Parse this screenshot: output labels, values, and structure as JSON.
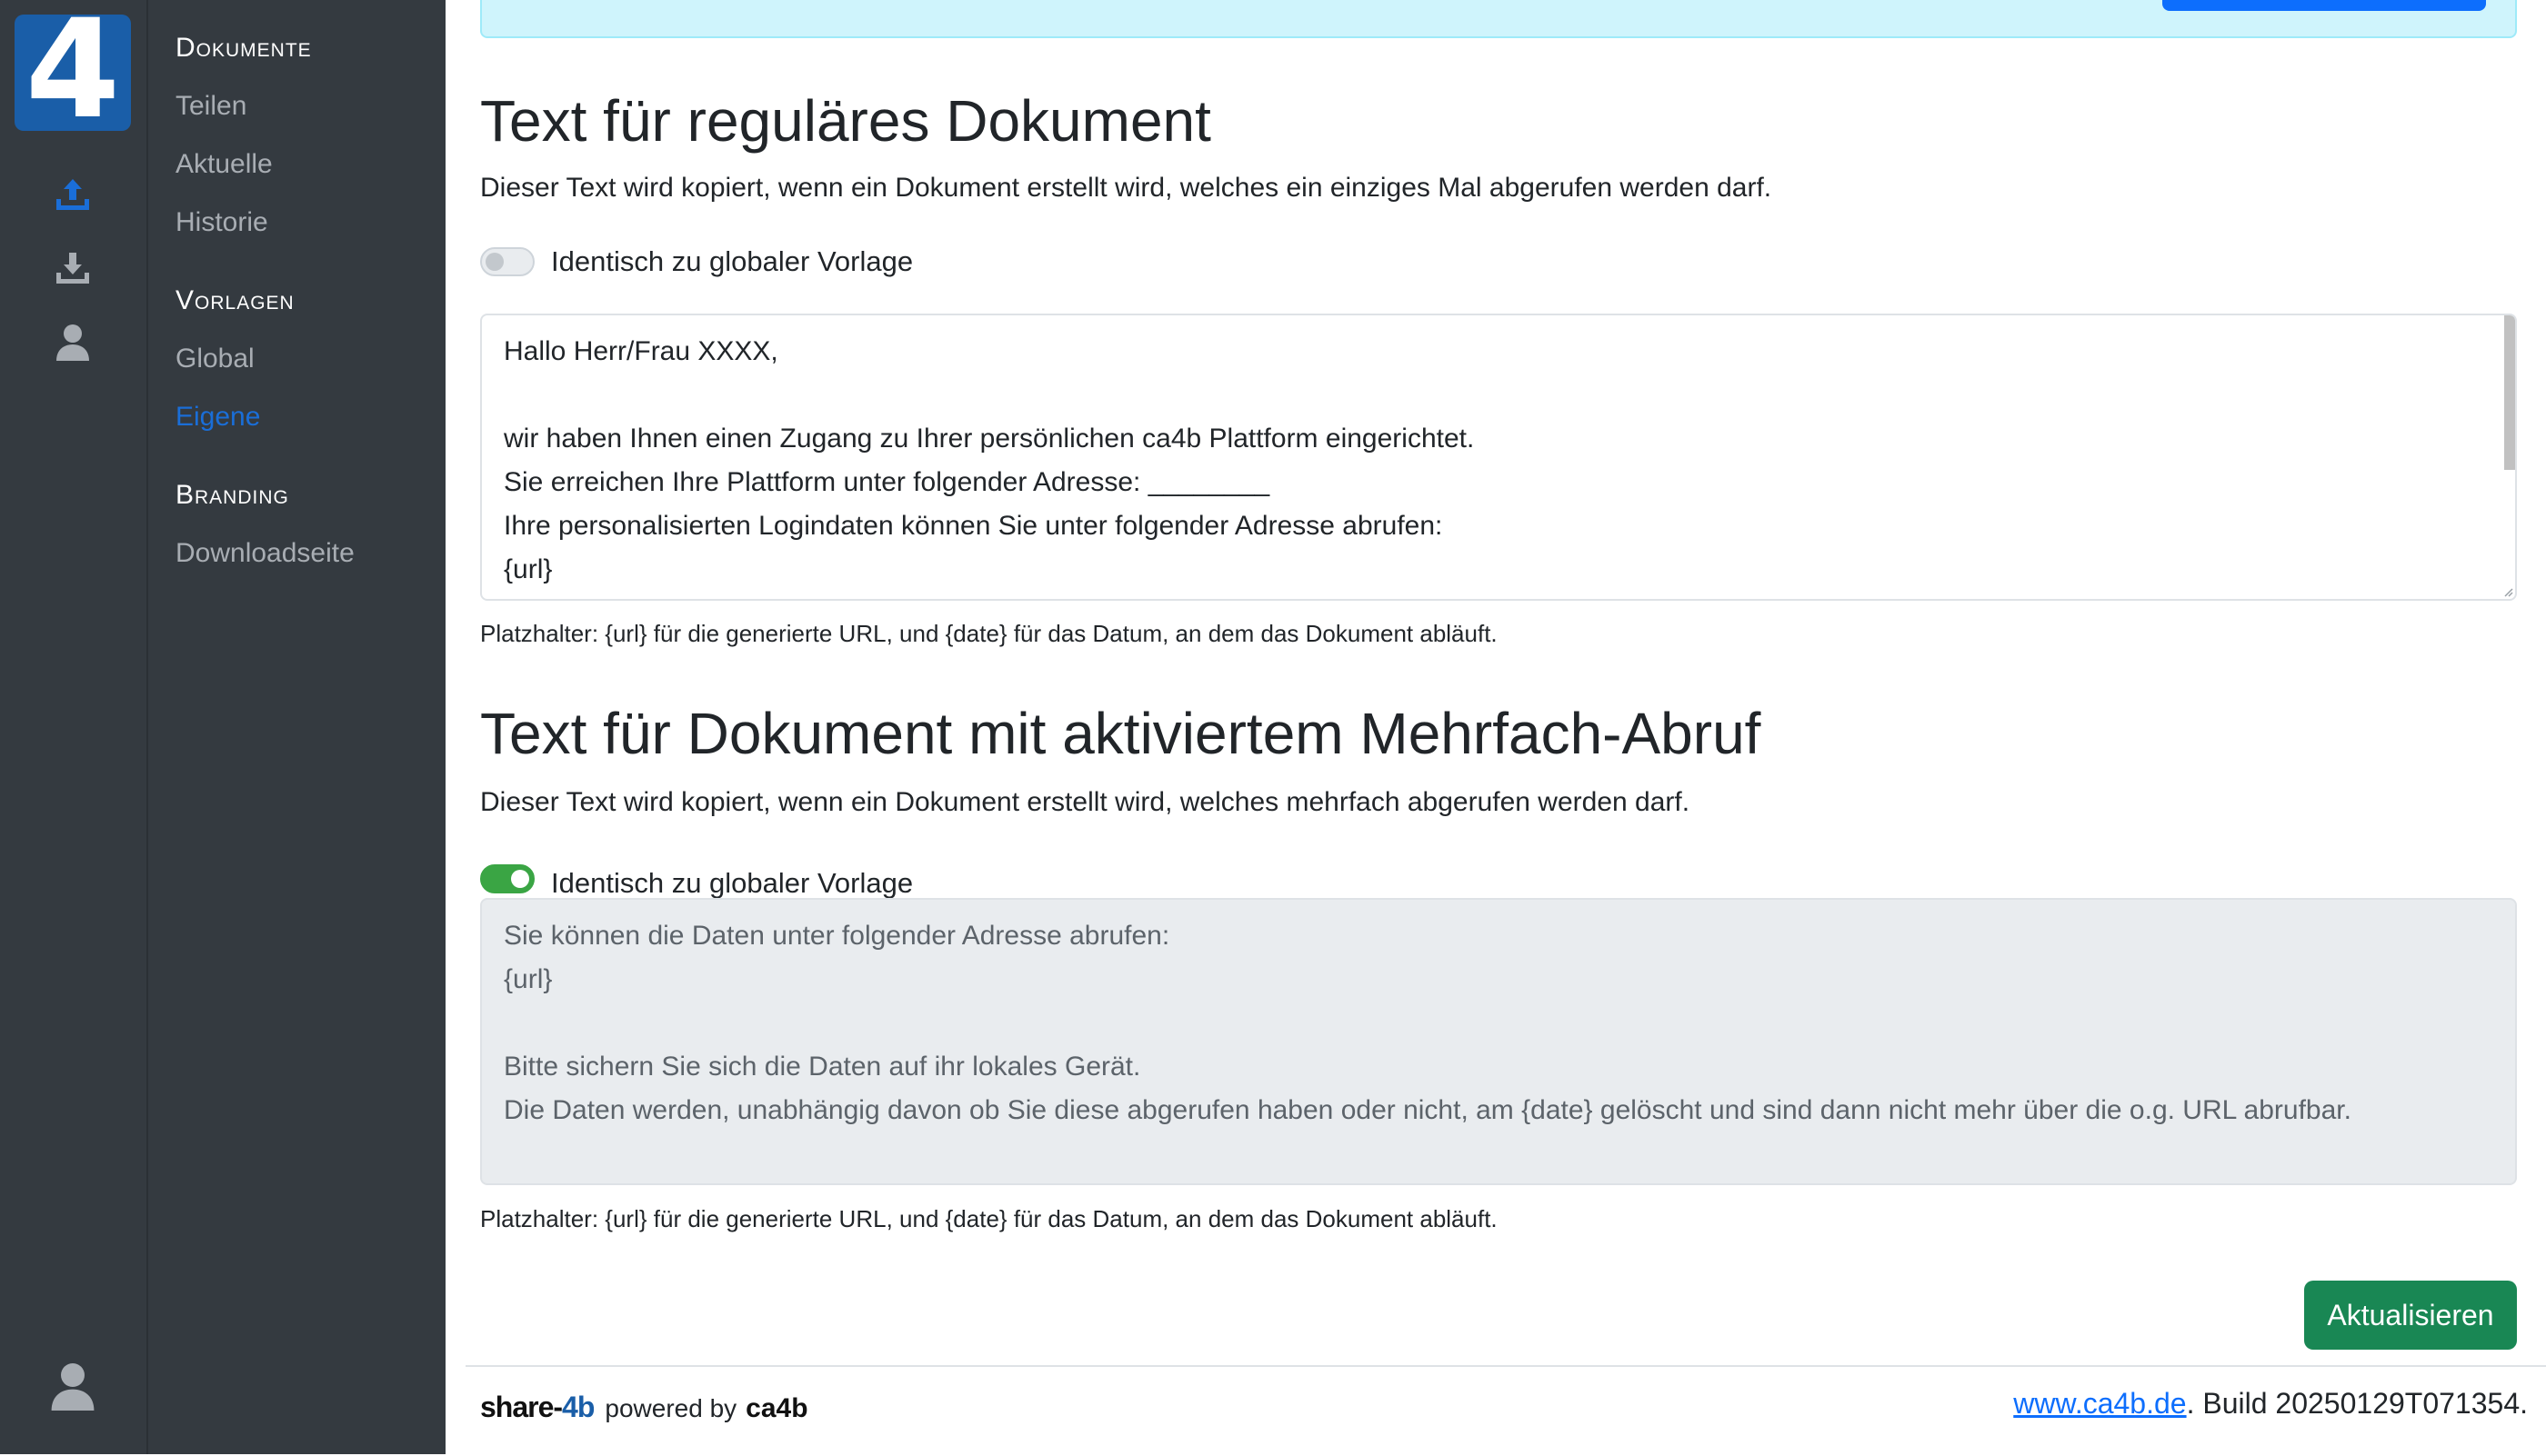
{
  "logo": {
    "glyph": "4"
  },
  "rail": {
    "icons": [
      "upload-icon",
      "download-icon",
      "user-icon"
    ],
    "bottom_icon": "user-profile-icon"
  },
  "menu": {
    "dokumente": "Dokumente",
    "teilen": "Teilen",
    "aktuelle": "Aktuelle",
    "historie": "Historie",
    "vorlagen": "Vorlagen",
    "global": "Global",
    "eigene": "Eigene",
    "branding": "Branding",
    "downloadseite": "Downloadseite",
    "active_item": "Eigene"
  },
  "regular": {
    "title": "Text für reguläres Dokument",
    "description": "Dieser Text wird kopiert, wenn ein Dokument erstellt wird, welches ein einziges Mal abgerufen werden darf.",
    "switch_label": "Identisch zu globaler Vorlage",
    "switch_on": false,
    "lines": [
      "Hallo Herr/Frau XXXX,",
      "",
      "wir haben Ihnen einen Zugang zu Ihrer persönlichen ca4b Plattform eingerichtet.",
      "Sie erreichen Ihre Plattform unter folgender Adresse: ________",
      "Ihre personalisierten Logindaten können Sie unter folgender Adresse abrufen:",
      "{url}"
    ],
    "hint": "Platzhalter: {url} für die generierte URL, und {date} für das Datum, an dem das Dokument abläuft."
  },
  "multi": {
    "title": "Text für Dokument mit aktiviertem Mehrfach-Abruf",
    "description": "Dieser Text wird kopiert, wenn ein Dokument erstellt wird, welches mehrfach abgerufen werden darf.",
    "switch_label": "Identisch zu globaler Vorlage",
    "switch_on": true,
    "lines": [
      "Sie können die Daten unter folgender Adresse abrufen:",
      "{url}",
      "",
      "Bitte sichern Sie sich die Daten auf ihr lokales Gerät.",
      "Die Daten werden, unabhängig davon ob Sie diese abgerufen haben oder nicht, am {date} gelöscht und sind dann nicht mehr über die o.g. URL abrufbar."
    ],
    "hint": "Platzhalter: {url} für die generierte URL, und {date} für das Datum, an dem das Dokument abläuft."
  },
  "update_button": "Aktualisieren",
  "footer": {
    "brand_share": "share-",
    "brand_4b": "4b",
    "powered_by": "powered by",
    "brand_ca": "ca4b",
    "link_text": "www.ca4b.de",
    "build_text": ". Build 20250129T071354."
  },
  "colors": {
    "sidebar": "#343a40",
    "active": "#1a6ed8",
    "info": "#cff4fc",
    "switch_on": "#3aa544",
    "update_button": "#198754"
  }
}
